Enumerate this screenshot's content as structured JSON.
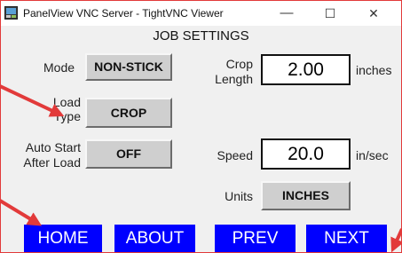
{
  "window": {
    "title": "PanelView VNC Server - TightVNC Viewer",
    "minimize_glyph": "—",
    "maximize_glyph": "☐",
    "close_glyph": "✕"
  },
  "page": {
    "title": "JOB SETTINGS"
  },
  "settings": {
    "mode": {
      "label": "Mode",
      "value": "NON-STICK"
    },
    "load_type": {
      "label_line1": "Load",
      "label_line2": "Type",
      "value": "CROP"
    },
    "auto_start": {
      "label_line1": "Auto Start",
      "label_line2": "After Load",
      "value": "OFF"
    },
    "crop_length": {
      "label_line1": "Crop",
      "label_line2": "Length",
      "value": "2.00",
      "unit": "inches"
    },
    "speed": {
      "label": "Speed",
      "value": "20.0",
      "unit": "in/sec"
    },
    "units": {
      "label": "Units",
      "value": "INCHES"
    }
  },
  "nav": {
    "home": "HOME",
    "about": "ABOUT",
    "prev": "PREV",
    "next": "NEXT"
  },
  "colors": {
    "nav_button": "#0000ff",
    "annotation_arrow": "#e23a3a",
    "window_border": "#e23a3a"
  }
}
